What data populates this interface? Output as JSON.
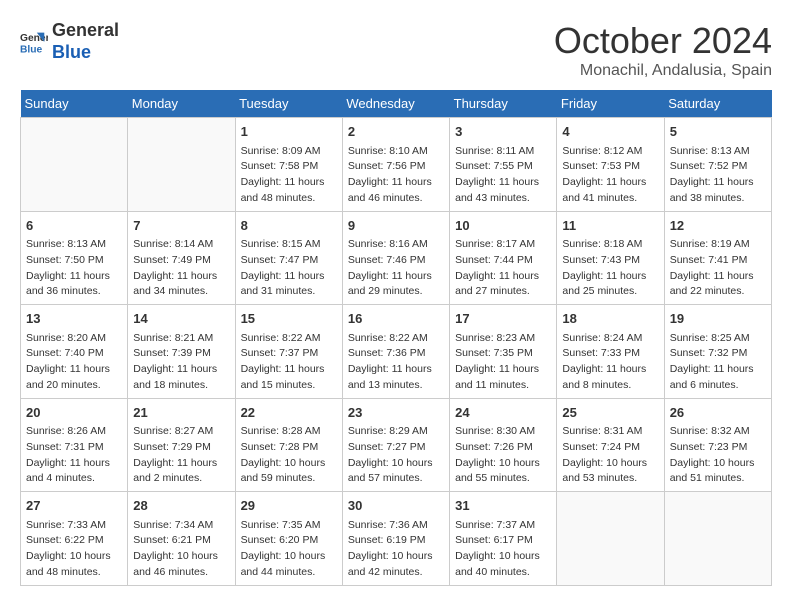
{
  "header": {
    "logo": {
      "line1": "General",
      "line2": "Blue"
    },
    "month": "October 2024",
    "location": "Monachil, Andalusia, Spain"
  },
  "weekdays": [
    "Sunday",
    "Monday",
    "Tuesday",
    "Wednesday",
    "Thursday",
    "Friday",
    "Saturday"
  ],
  "weeks": [
    [
      {
        "day": "",
        "info": ""
      },
      {
        "day": "",
        "info": ""
      },
      {
        "day": "1",
        "info": "Sunrise: 8:09 AM\nSunset: 7:58 PM\nDaylight: 11 hours and 48 minutes."
      },
      {
        "day": "2",
        "info": "Sunrise: 8:10 AM\nSunset: 7:56 PM\nDaylight: 11 hours and 46 minutes."
      },
      {
        "day": "3",
        "info": "Sunrise: 8:11 AM\nSunset: 7:55 PM\nDaylight: 11 hours and 43 minutes."
      },
      {
        "day": "4",
        "info": "Sunrise: 8:12 AM\nSunset: 7:53 PM\nDaylight: 11 hours and 41 minutes."
      },
      {
        "day": "5",
        "info": "Sunrise: 8:13 AM\nSunset: 7:52 PM\nDaylight: 11 hours and 38 minutes."
      }
    ],
    [
      {
        "day": "6",
        "info": "Sunrise: 8:13 AM\nSunset: 7:50 PM\nDaylight: 11 hours and 36 minutes."
      },
      {
        "day": "7",
        "info": "Sunrise: 8:14 AM\nSunset: 7:49 PM\nDaylight: 11 hours and 34 minutes."
      },
      {
        "day": "8",
        "info": "Sunrise: 8:15 AM\nSunset: 7:47 PM\nDaylight: 11 hours and 31 minutes."
      },
      {
        "day": "9",
        "info": "Sunrise: 8:16 AM\nSunset: 7:46 PM\nDaylight: 11 hours and 29 minutes."
      },
      {
        "day": "10",
        "info": "Sunrise: 8:17 AM\nSunset: 7:44 PM\nDaylight: 11 hours and 27 minutes."
      },
      {
        "day": "11",
        "info": "Sunrise: 8:18 AM\nSunset: 7:43 PM\nDaylight: 11 hours and 25 minutes."
      },
      {
        "day": "12",
        "info": "Sunrise: 8:19 AM\nSunset: 7:41 PM\nDaylight: 11 hours and 22 minutes."
      }
    ],
    [
      {
        "day": "13",
        "info": "Sunrise: 8:20 AM\nSunset: 7:40 PM\nDaylight: 11 hours and 20 minutes."
      },
      {
        "day": "14",
        "info": "Sunrise: 8:21 AM\nSunset: 7:39 PM\nDaylight: 11 hours and 18 minutes."
      },
      {
        "day": "15",
        "info": "Sunrise: 8:22 AM\nSunset: 7:37 PM\nDaylight: 11 hours and 15 minutes."
      },
      {
        "day": "16",
        "info": "Sunrise: 8:22 AM\nSunset: 7:36 PM\nDaylight: 11 hours and 13 minutes."
      },
      {
        "day": "17",
        "info": "Sunrise: 8:23 AM\nSunset: 7:35 PM\nDaylight: 11 hours and 11 minutes."
      },
      {
        "day": "18",
        "info": "Sunrise: 8:24 AM\nSunset: 7:33 PM\nDaylight: 11 hours and 8 minutes."
      },
      {
        "day": "19",
        "info": "Sunrise: 8:25 AM\nSunset: 7:32 PM\nDaylight: 11 hours and 6 minutes."
      }
    ],
    [
      {
        "day": "20",
        "info": "Sunrise: 8:26 AM\nSunset: 7:31 PM\nDaylight: 11 hours and 4 minutes."
      },
      {
        "day": "21",
        "info": "Sunrise: 8:27 AM\nSunset: 7:29 PM\nDaylight: 11 hours and 2 minutes."
      },
      {
        "day": "22",
        "info": "Sunrise: 8:28 AM\nSunset: 7:28 PM\nDaylight: 10 hours and 59 minutes."
      },
      {
        "day": "23",
        "info": "Sunrise: 8:29 AM\nSunset: 7:27 PM\nDaylight: 10 hours and 57 minutes."
      },
      {
        "day": "24",
        "info": "Sunrise: 8:30 AM\nSunset: 7:26 PM\nDaylight: 10 hours and 55 minutes."
      },
      {
        "day": "25",
        "info": "Sunrise: 8:31 AM\nSunset: 7:24 PM\nDaylight: 10 hours and 53 minutes."
      },
      {
        "day": "26",
        "info": "Sunrise: 8:32 AM\nSunset: 7:23 PM\nDaylight: 10 hours and 51 minutes."
      }
    ],
    [
      {
        "day": "27",
        "info": "Sunrise: 7:33 AM\nSunset: 6:22 PM\nDaylight: 10 hours and 48 minutes."
      },
      {
        "day": "28",
        "info": "Sunrise: 7:34 AM\nSunset: 6:21 PM\nDaylight: 10 hours and 46 minutes."
      },
      {
        "day": "29",
        "info": "Sunrise: 7:35 AM\nSunset: 6:20 PM\nDaylight: 10 hours and 44 minutes."
      },
      {
        "day": "30",
        "info": "Sunrise: 7:36 AM\nSunset: 6:19 PM\nDaylight: 10 hours and 42 minutes."
      },
      {
        "day": "31",
        "info": "Sunrise: 7:37 AM\nSunset: 6:17 PM\nDaylight: 10 hours and 40 minutes."
      },
      {
        "day": "",
        "info": ""
      },
      {
        "day": "",
        "info": ""
      }
    ]
  ]
}
